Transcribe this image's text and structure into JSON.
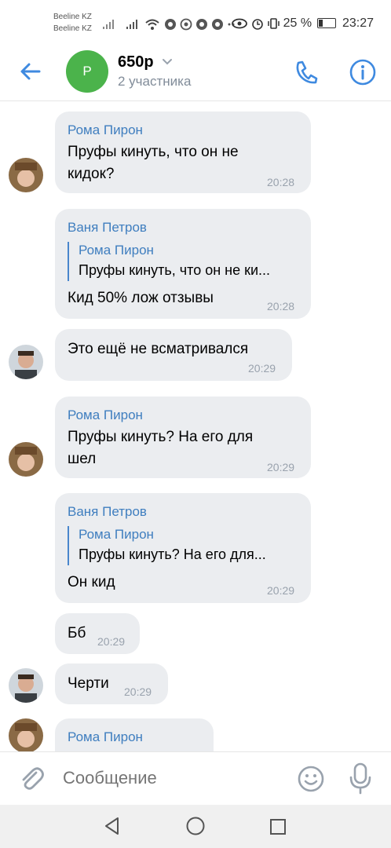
{
  "status_bar": {
    "carrier1": "Beeline KZ",
    "carrier2": "Beeline KZ",
    "battery": "25 %",
    "time": "23:27"
  },
  "header": {
    "avatar_letter": "Р",
    "title": "650р",
    "subtitle": "2 участника"
  },
  "messages": [
    {
      "author": "Рома Пирон",
      "lines": [
        "Пруфы кинуть, что он не",
        "кидок?"
      ],
      "time": "20:28"
    },
    {
      "author": "Ваня Петров",
      "reply_author": "Рома Пирон",
      "reply_text": "Пруфы кинуть, что он не ки...",
      "text": "Кид 50% лож отзывы",
      "time": "20:28"
    },
    {
      "text": "Это ещё не всматривался",
      "time": "20:29"
    },
    {
      "author": "Рома Пирон",
      "lines": [
        "Пруфы кинуть? На его для",
        "шел"
      ],
      "time": "20:29"
    },
    {
      "author": "Ваня Петров",
      "reply_author": "Рома Пирон",
      "reply_text": "Пруфы кинуть? На его для...",
      "text": "Он кид",
      "time": "20:29"
    },
    {
      "text": "Бб",
      "time": "20:29"
    },
    {
      "text": "Черти",
      "time": "20:29"
    },
    {
      "author": "Рома Пирон"
    }
  ],
  "composer": {
    "placeholder": "Сообщение"
  },
  "colors": {
    "accent": "#3f8ae0",
    "bubble": "#ebedf0",
    "avatar_green": "#4bb34b"
  },
  "icons": [
    "back-arrow-icon",
    "chevron-down-icon",
    "phone-icon",
    "info-icon",
    "attach-icon",
    "emoji-icon",
    "mic-icon"
  ]
}
